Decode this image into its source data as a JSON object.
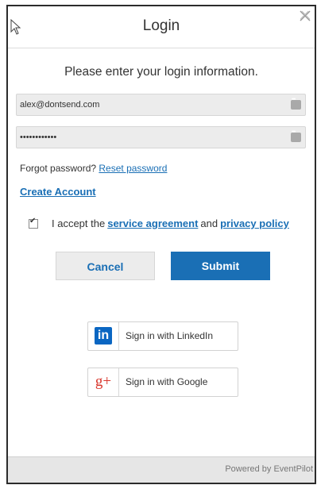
{
  "background_text": "",
  "dialog": {
    "title": "Login",
    "instructions": "Please enter your login information.",
    "email_value": "alex@dontsend.com",
    "password_value": "••••••••••••",
    "forgot_text": "Forgot password?",
    "reset_link": "Reset password",
    "create_account": "Create Account",
    "terms_prefix": "I accept the",
    "service_agreement": "service agreement",
    "terms_and": "and",
    "privacy_policy": "privacy policy",
    "cancel_label": "Cancel",
    "submit_label": "Submit",
    "linkedin_label": "Sign in with LinkedIn",
    "linkedin_glyph": "in",
    "google_label": "Sign in with Google",
    "google_glyph": "g+",
    "footer": "Powered by EventPilot"
  },
  "colors": {
    "accent": "#1a6fb5",
    "linkedin": "#0a66c2",
    "google": "#d9352b"
  }
}
